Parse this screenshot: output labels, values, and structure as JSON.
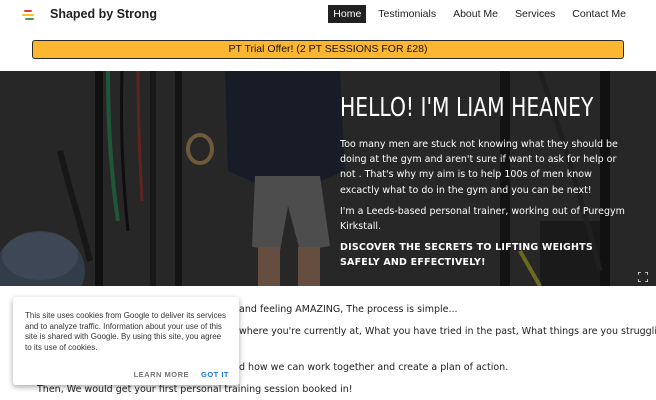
{
  "header": {
    "site_title": "Shaped by Strong",
    "nav": [
      {
        "label": "Home",
        "active": true
      },
      {
        "label": "Testimonials",
        "active": false
      },
      {
        "label": "About Me",
        "active": false
      },
      {
        "label": "Services",
        "active": false
      },
      {
        "label": "Contact Me",
        "active": false
      }
    ]
  },
  "banner": {
    "offer_label": "PT Trial Offer! (2 PT SESSIONS FOR £28)",
    "color": "#fcb630"
  },
  "hero": {
    "title": "HELLO! I'M LIAM HEANEY",
    "paragraph1": "Too many men are stuck not knowing what they should be doing at the gym and aren't sure if want to ask for help or not . That's why my aim is to help 100s of men know excactly what to do in the gym and you can be next!",
    "paragraph2": "I'm a Leeds-based personal trainer, working out of Puregym Kirkstall.",
    "paragraph3": "DISCOVER THE SECRETS TO LIFTING WEIGHTS SAFELY AND EFFECTIVELY!"
  },
  "body": {
    "line1": "and feeling AMAZING, The process is simple...",
    "line2": "where you're currently at, What you have tried in the past, What things are you struggling",
    "line3": "d how we can work together and create a plan of action.",
    "line4": "Then, We would get your first personal training session booked in!"
  },
  "cookie": {
    "text": "This site uses cookies from Google to deliver its services and to analyze traffic. Information about your use of this site is shared with Google. By using this site, you agree to its use of cookies.",
    "learn_more": "LEARN MORE",
    "got_it": "GOT IT"
  }
}
